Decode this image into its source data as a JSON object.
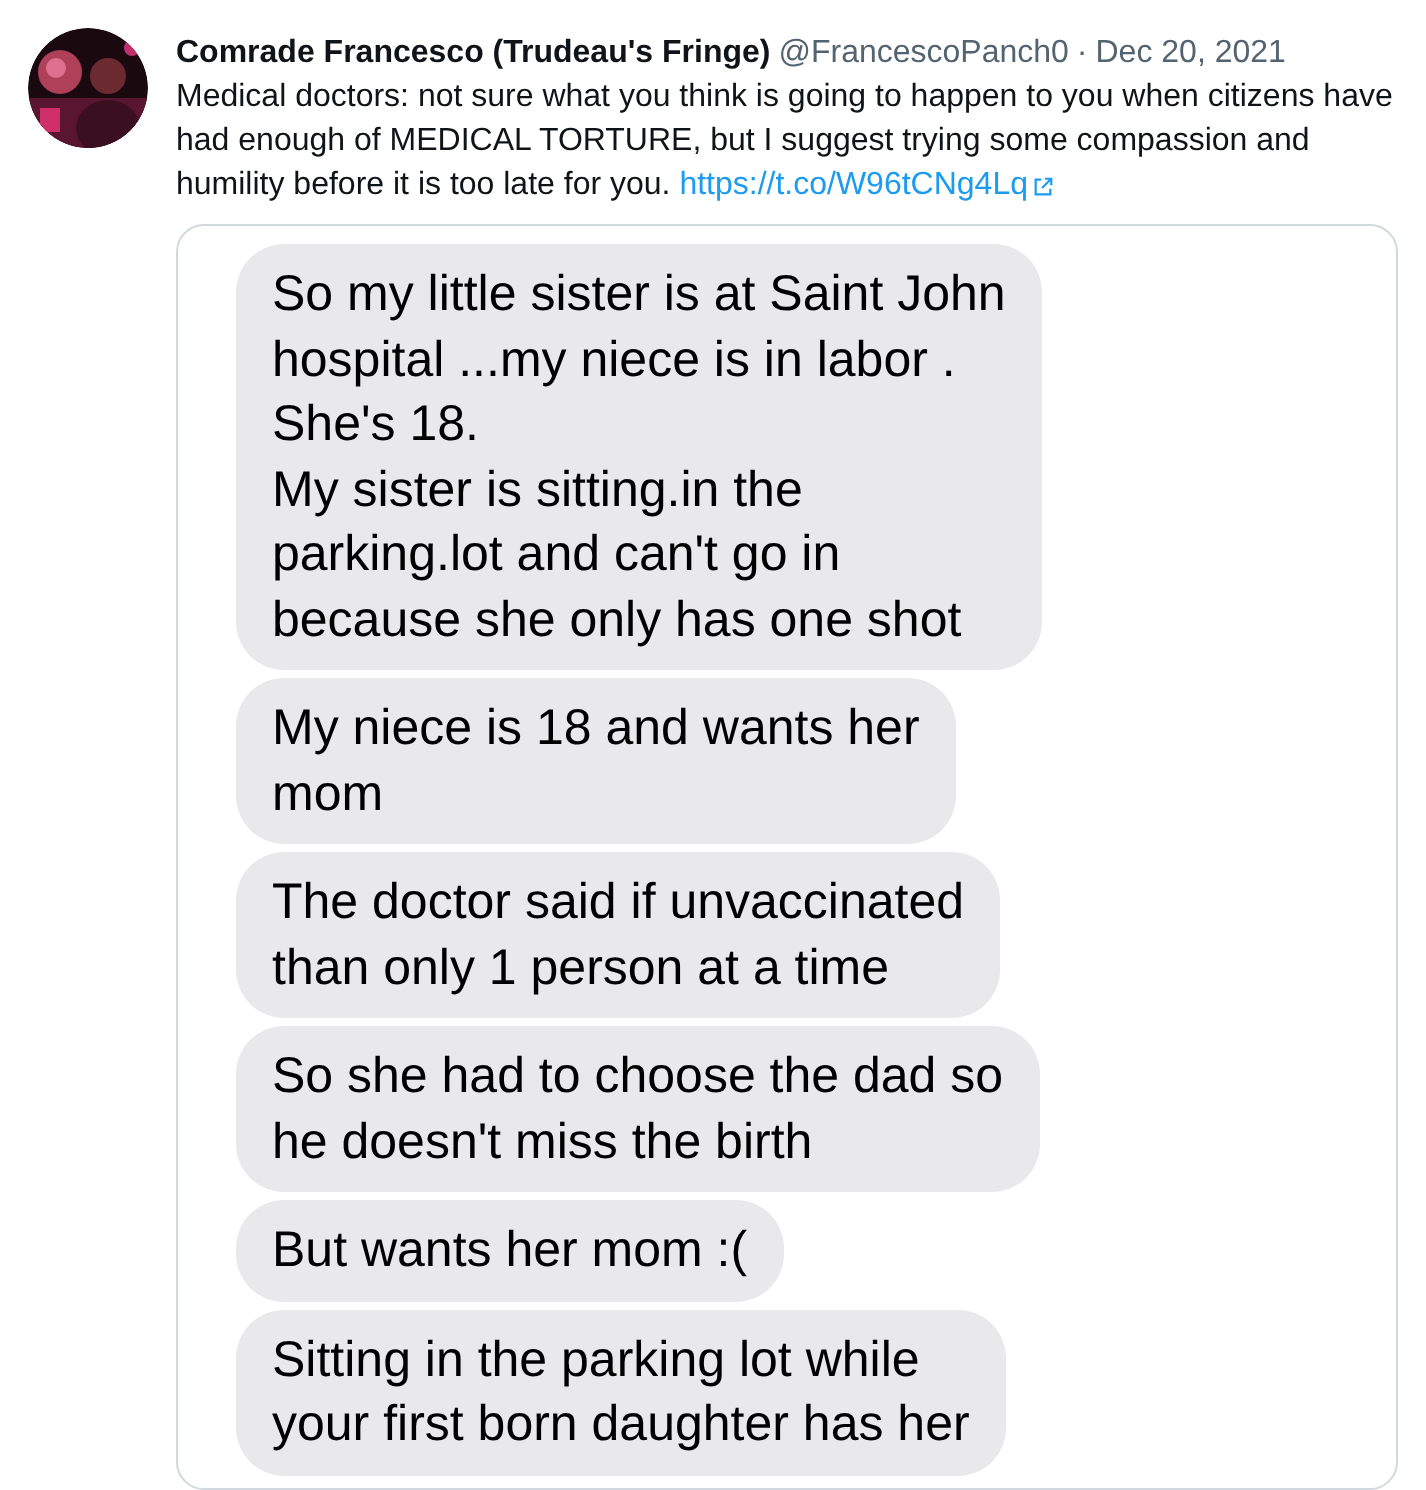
{
  "tweet": {
    "name": "Comrade Francesco (Trudeau's Fringe)",
    "handle": "@FrancescoPanch0",
    "separator": "·",
    "date": "Dec 20, 2021",
    "text": "Medical doctors: not sure what you think is going to happen to you when citizens have had enough of MEDICAL TORTURE, but I suggest trying some compassion and humility before it is too late for you.",
    "link": "https://t.co/W96tCNg4Lq"
  },
  "messages": [
    {
      "text": "So my little sister is at Saint John\nhospital ...my niece is in labor .\nShe's 18.\nMy sister is sitting.in the\nparking.lot and can't go in\nbecause she only has one shot"
    },
    {
      "text": "My niece is 18 and wants her\nmom"
    },
    {
      "text": "The doctor said if unvaccinated\nthan only 1 person at a time"
    },
    {
      "text": "So she had to choose the dad so\nhe doesn't miss the birth"
    },
    {
      "text": "But wants her mom :("
    },
    {
      "text": "Sitting in the parking lot while\nyour first born daughter has her"
    }
  ]
}
